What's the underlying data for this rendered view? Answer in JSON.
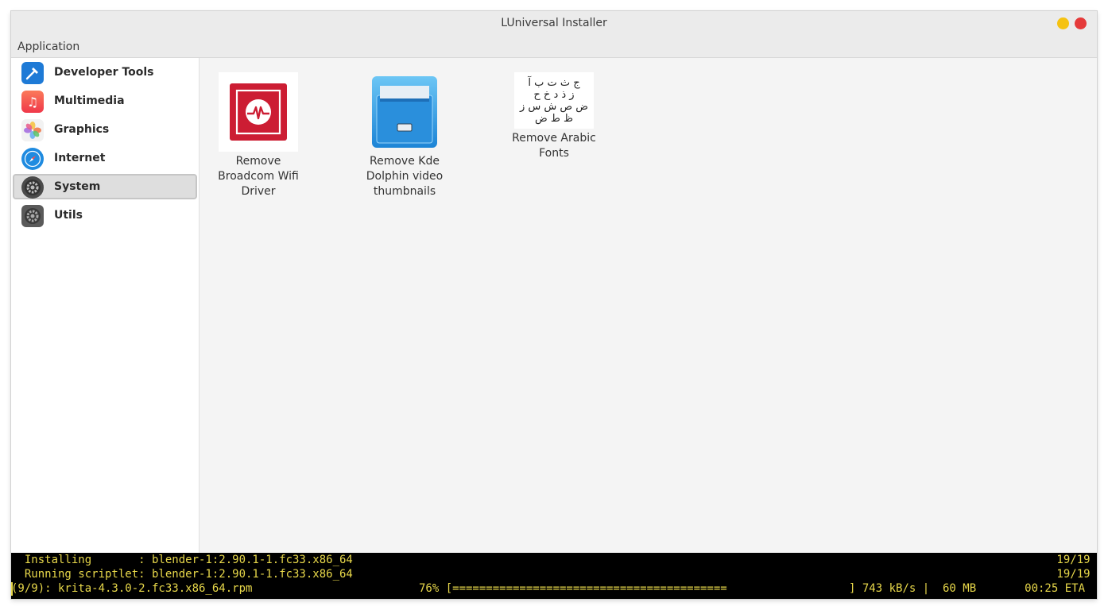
{
  "window": {
    "title": "LUniversal Installer"
  },
  "menubar": {
    "items": [
      "Application"
    ]
  },
  "sidebar": {
    "items": [
      {
        "label": "Developer Tools",
        "icon": "hammer-icon",
        "color": "#1e7ad6"
      },
      {
        "label": "Multimedia",
        "icon": "music-note-icon",
        "color": "#f5554a"
      },
      {
        "label": "Graphics",
        "icon": "flower-icon",
        "color": "#f0b23c"
      },
      {
        "label": "Internet",
        "icon": "compass-icon",
        "color": "#1f8be0"
      },
      {
        "label": "System",
        "icon": "gear-icon",
        "color": "#4b4b4b",
        "selected": true
      },
      {
        "label": "Utils",
        "icon": "gear-icon",
        "color": "#5a5a5a"
      }
    ]
  },
  "apps": [
    {
      "label": "Remove Broadcom Wifi Driver",
      "icon": "broadcom-logo-icon"
    },
    {
      "label": "Remove Kde Dolphin video thumbnails",
      "icon": "file-cabinet-icon"
    },
    {
      "label": "Remove Arabic Fonts",
      "icon": "arabic-letters-icon",
      "glyphs": [
        "ج ث ت ب آ",
        "ز ذ د خ ح",
        "ض ص ش س ز",
        "ظ ط ض"
      ]
    }
  ],
  "terminal": {
    "lines": [
      {
        "left": "  Installing       : blender-1:2.90.1-1.fc33.x86_64",
        "right": "19/19 "
      },
      {
        "left": "  Running scriptlet: blender-1:2.90.1-1.fc33.x86_64",
        "right": "19/19 "
      },
      {
        "left": "(9/9): krita-4.3.0-2.fc33.x86_64.rpm",
        "middle": "76% [=========================================",
        "rate": "] 743 kB/s |  60 MB",
        "eta": "00:25 ETA"
      }
    ],
    "progress_percent": 76
  }
}
